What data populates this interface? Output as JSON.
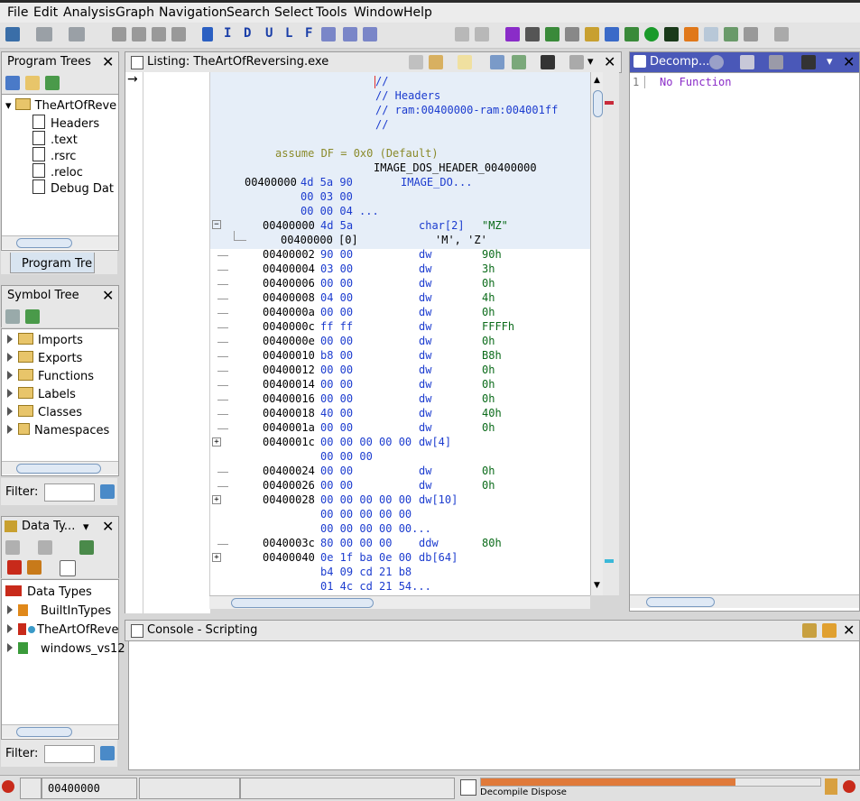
{
  "menu": {
    "file": "File",
    "edit": "Edit",
    "analysis": "Analysis",
    "graph": "Graph",
    "navigation": "Navigation",
    "search": "Search",
    "select": "Select",
    "tools": "Tools",
    "window": "Window",
    "help": "Help"
  },
  "toolbar_letters": [
    "I",
    "D",
    "U",
    "L",
    "F"
  ],
  "program_trees": {
    "title": "Program Trees",
    "root": "TheArtOfReve",
    "items": [
      "Headers",
      ".text",
      ".rsrc",
      ".reloc",
      "Debug Dat"
    ],
    "tab": "Program Tre"
  },
  "symbol_tree": {
    "title": "Symbol Tree",
    "items": [
      "Imports",
      "Exports",
      "Functions",
      "Labels",
      "Classes",
      "Namespaces"
    ],
    "filter_label": "Filter:"
  },
  "data_types": {
    "title": "Data Ty...",
    "root": "Data Types",
    "items": [
      "BuiltInTypes",
      "TheArtOfReve",
      "windows_vs12"
    ],
    "filter_label": "Filter:"
  },
  "listing": {
    "title": "Listing:  TheArtOfReversing.exe",
    "comment1": "//",
    "comment2": "// Headers",
    "comment3": "// ram:00400000-ram:004001ff",
    "comment4": "//",
    "assume": "assume DF = 0x0  (Default)",
    "header_label": "IMAGE_DOS_HEADER_00400000",
    "header_addr": "00400000",
    "header_bytes1": "4d 5a 90",
    "header_bytes2": "00 03 00",
    "header_bytes3": "00 00 04 ...",
    "header_type": "IMAGE_DO...",
    "char_addr": "00400000",
    "char_bytes": "4d 5a",
    "char_type": "char[2]",
    "char_val": "\"MZ\"",
    "sub_addr": "00400000",
    "sub_idx": "[0]",
    "sub_val": "'M', 'Z'",
    "rows": [
      {
        "a": "00400002",
        "b": "90 00",
        "m": "dw",
        "o": "90h"
      },
      {
        "a": "00400004",
        "b": "03 00",
        "m": "dw",
        "o": "3h"
      },
      {
        "a": "00400006",
        "b": "00 00",
        "m": "dw",
        "o": "0h"
      },
      {
        "a": "00400008",
        "b": "04 00",
        "m": "dw",
        "o": "4h"
      },
      {
        "a": "0040000a",
        "b": "00 00",
        "m": "dw",
        "o": "0h"
      },
      {
        "a": "0040000c",
        "b": "ff ff",
        "m": "dw",
        "o": "FFFFh"
      },
      {
        "a": "0040000e",
        "b": "00 00",
        "m": "dw",
        "o": "0h"
      },
      {
        "a": "00400010",
        "b": "b8 00",
        "m": "dw",
        "o": "B8h"
      },
      {
        "a": "00400012",
        "b": "00 00",
        "m": "dw",
        "o": "0h"
      },
      {
        "a": "00400014",
        "b": "00 00",
        "m": "dw",
        "o": "0h"
      },
      {
        "a": "00400016",
        "b": "00 00",
        "m": "dw",
        "o": "0h"
      },
      {
        "a": "00400018",
        "b": "40 00",
        "m": "dw",
        "o": "40h"
      },
      {
        "a": "0040001a",
        "b": "00 00",
        "m": "dw",
        "o": "0h"
      }
    ],
    "r1c_addr": "0040001c",
    "r1c_b1": "00 00 00 00 00",
    "r1c_b2": "00 00 00",
    "r1c_m": "dw[4]",
    "r24": {
      "a": "00400024",
      "b": "00 00",
      "m": "dw",
      "o": "0h"
    },
    "r26": {
      "a": "00400026",
      "b": "00 00",
      "m": "dw",
      "o": "0h"
    },
    "r28_addr": "00400028",
    "r28_b1": "00 00 00 00 00",
    "r28_b2": "00 00 00 00 00",
    "r28_b3": "00 00 00 00 00...",
    "r28_m": "dw[10]",
    "r3c": {
      "a": "0040003c",
      "b": "80 00 00 00",
      "m": "ddw",
      "o": "80h"
    },
    "r40_addr": "00400040",
    "r40_b1": "0e 1f ba 0e 00",
    "r40_b2": "b4 09 cd 21 b8",
    "r40_b3": "01 4c cd 21 54...",
    "r40_m": "db[64]"
  },
  "decompiler": {
    "title": "Decomp...",
    "line_no": "1",
    "text": "No Function"
  },
  "console": {
    "title": "Console - Scripting"
  },
  "status": {
    "address": "00400000",
    "task": "Decompile Dispose",
    "progress": 0.75
  }
}
